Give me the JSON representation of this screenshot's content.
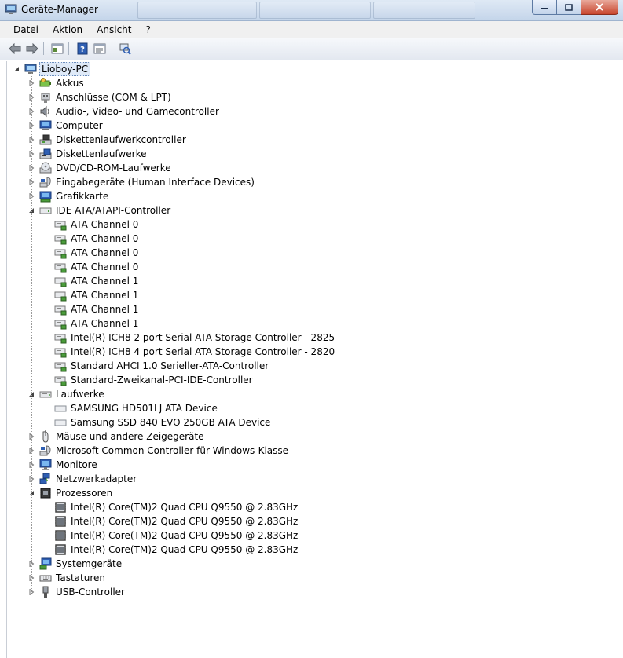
{
  "window": {
    "title": "Geräte-Manager"
  },
  "menu": {
    "items": [
      "Datei",
      "Aktion",
      "Ansicht",
      "?"
    ]
  },
  "tree": {
    "root": "Lioboy-PC",
    "categories": [
      {
        "label": "Akkus",
        "icon": "battery-icon"
      },
      {
        "label": "Anschlüsse (COM & LPT)",
        "icon": "port-icon"
      },
      {
        "label": "Audio-, Video- und Gamecontroller",
        "icon": "speaker-icon"
      },
      {
        "label": "Computer",
        "icon": "computer-icon"
      },
      {
        "label": "Diskettenlaufwerkcontroller",
        "icon": "floppy-controller-icon"
      },
      {
        "label": "Diskettenlaufwerke",
        "icon": "floppy-drive-icon"
      },
      {
        "label": "DVD/CD-ROM-Laufwerke",
        "icon": "dvd-drive-icon"
      },
      {
        "label": "Eingabegeräte (Human Interface Devices)",
        "icon": "hid-icon"
      },
      {
        "label": "Grafikkarte",
        "icon": "display-adapter-icon"
      },
      {
        "label": "IDE ATA/ATAPI-Controller",
        "icon": "ide-controller-icon",
        "children": [
          "ATA Channel 0",
          "ATA Channel 0",
          "ATA Channel 0",
          "ATA Channel 0",
          "ATA Channel 1",
          "ATA Channel 1",
          "ATA Channel 1",
          "ATA Channel 1",
          "Intel(R) ICH8 2 port Serial ATA Storage Controller - 2825",
          "Intel(R) ICH8 4 port Serial ATA Storage Controller - 2820",
          "Standard AHCI 1.0 Serieller-ATA-Controller",
          "Standard-Zweikanal-PCI-IDE-Controller"
        ]
      },
      {
        "label": "Laufwerke",
        "icon": "disk-drive-icon",
        "children": [
          "SAMSUNG HD501LJ ATA Device",
          "Samsung SSD 840 EVO 250GB ATA Device"
        ]
      },
      {
        "label": "Mäuse und andere Zeigegeräte",
        "icon": "mouse-icon"
      },
      {
        "label": "Microsoft Common Controller für Windows-Klasse",
        "icon": "common-controller-icon"
      },
      {
        "label": "Monitore",
        "icon": "monitor-icon"
      },
      {
        "label": "Netzwerkadapter",
        "icon": "network-adapter-icon"
      },
      {
        "label": "Prozessoren",
        "icon": "processor-icon",
        "children": [
          "Intel(R) Core(TM)2 Quad CPU    Q9550  @ 2.83GHz",
          "Intel(R) Core(TM)2 Quad CPU    Q9550  @ 2.83GHz",
          "Intel(R) Core(TM)2 Quad CPU    Q9550  @ 2.83GHz",
          "Intel(R) Core(TM)2 Quad CPU    Q9550  @ 2.83GHz"
        ]
      },
      {
        "label": "Systemgeräte",
        "icon": "system-devices-icon"
      },
      {
        "label": "Tastaturen",
        "icon": "keyboard-icon"
      },
      {
        "label": "USB-Controller",
        "icon": "usb-icon"
      }
    ]
  },
  "colors": {
    "selection": "#dfeaf8",
    "titlebar": "#c4d5ea",
    "toolbar": "#e3e8f0"
  }
}
